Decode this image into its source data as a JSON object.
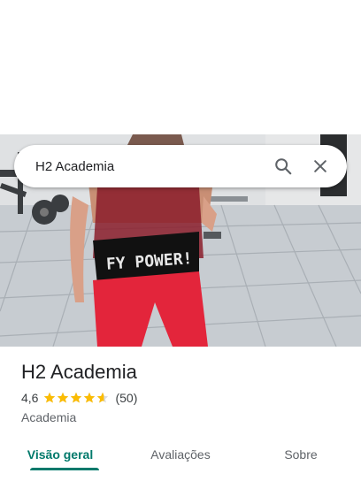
{
  "search": {
    "query": "H2 Academia"
  },
  "place": {
    "name": "H2 Academia",
    "rating": "4,6",
    "rating_stars": 4.6,
    "review_count": "(50)",
    "category": "Academia"
  },
  "tabs": [
    {
      "label": "Visão geral",
      "active": true
    },
    {
      "label": "Avaliações",
      "active": false
    },
    {
      "label": "Sobre",
      "active": false
    }
  ],
  "colors": {
    "accent": "#00796b",
    "star": "#fbbc04",
    "star_empty": "#dadce0"
  },
  "icons": {
    "search": "search-icon",
    "close": "close-icon",
    "star": "star-icon"
  }
}
